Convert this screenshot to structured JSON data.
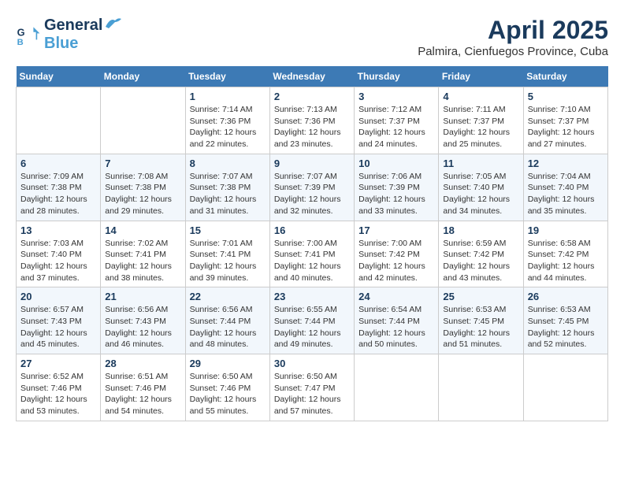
{
  "header": {
    "logo_line1": "General",
    "logo_line2": "Blue",
    "month": "April 2025",
    "location": "Palmira, Cienfuegos Province, Cuba"
  },
  "days_of_week": [
    "Sunday",
    "Monday",
    "Tuesday",
    "Wednesday",
    "Thursday",
    "Friday",
    "Saturday"
  ],
  "weeks": [
    [
      {
        "day": "",
        "info": ""
      },
      {
        "day": "",
        "info": ""
      },
      {
        "day": "1",
        "info": "Sunrise: 7:14 AM\nSunset: 7:36 PM\nDaylight: 12 hours and 22 minutes."
      },
      {
        "day": "2",
        "info": "Sunrise: 7:13 AM\nSunset: 7:36 PM\nDaylight: 12 hours and 23 minutes."
      },
      {
        "day": "3",
        "info": "Sunrise: 7:12 AM\nSunset: 7:37 PM\nDaylight: 12 hours and 24 minutes."
      },
      {
        "day": "4",
        "info": "Sunrise: 7:11 AM\nSunset: 7:37 PM\nDaylight: 12 hours and 25 minutes."
      },
      {
        "day": "5",
        "info": "Sunrise: 7:10 AM\nSunset: 7:37 PM\nDaylight: 12 hours and 27 minutes."
      }
    ],
    [
      {
        "day": "6",
        "info": "Sunrise: 7:09 AM\nSunset: 7:38 PM\nDaylight: 12 hours and 28 minutes."
      },
      {
        "day": "7",
        "info": "Sunrise: 7:08 AM\nSunset: 7:38 PM\nDaylight: 12 hours and 29 minutes."
      },
      {
        "day": "8",
        "info": "Sunrise: 7:07 AM\nSunset: 7:38 PM\nDaylight: 12 hours and 31 minutes."
      },
      {
        "day": "9",
        "info": "Sunrise: 7:07 AM\nSunset: 7:39 PM\nDaylight: 12 hours and 32 minutes."
      },
      {
        "day": "10",
        "info": "Sunrise: 7:06 AM\nSunset: 7:39 PM\nDaylight: 12 hours and 33 minutes."
      },
      {
        "day": "11",
        "info": "Sunrise: 7:05 AM\nSunset: 7:40 PM\nDaylight: 12 hours and 34 minutes."
      },
      {
        "day": "12",
        "info": "Sunrise: 7:04 AM\nSunset: 7:40 PM\nDaylight: 12 hours and 35 minutes."
      }
    ],
    [
      {
        "day": "13",
        "info": "Sunrise: 7:03 AM\nSunset: 7:40 PM\nDaylight: 12 hours and 37 minutes."
      },
      {
        "day": "14",
        "info": "Sunrise: 7:02 AM\nSunset: 7:41 PM\nDaylight: 12 hours and 38 minutes."
      },
      {
        "day": "15",
        "info": "Sunrise: 7:01 AM\nSunset: 7:41 PM\nDaylight: 12 hours and 39 minutes."
      },
      {
        "day": "16",
        "info": "Sunrise: 7:00 AM\nSunset: 7:41 PM\nDaylight: 12 hours and 40 minutes."
      },
      {
        "day": "17",
        "info": "Sunrise: 7:00 AM\nSunset: 7:42 PM\nDaylight: 12 hours and 42 minutes."
      },
      {
        "day": "18",
        "info": "Sunrise: 6:59 AM\nSunset: 7:42 PM\nDaylight: 12 hours and 43 minutes."
      },
      {
        "day": "19",
        "info": "Sunrise: 6:58 AM\nSunset: 7:42 PM\nDaylight: 12 hours and 44 minutes."
      }
    ],
    [
      {
        "day": "20",
        "info": "Sunrise: 6:57 AM\nSunset: 7:43 PM\nDaylight: 12 hours and 45 minutes."
      },
      {
        "day": "21",
        "info": "Sunrise: 6:56 AM\nSunset: 7:43 PM\nDaylight: 12 hours and 46 minutes."
      },
      {
        "day": "22",
        "info": "Sunrise: 6:56 AM\nSunset: 7:44 PM\nDaylight: 12 hours and 48 minutes."
      },
      {
        "day": "23",
        "info": "Sunrise: 6:55 AM\nSunset: 7:44 PM\nDaylight: 12 hours and 49 minutes."
      },
      {
        "day": "24",
        "info": "Sunrise: 6:54 AM\nSunset: 7:44 PM\nDaylight: 12 hours and 50 minutes."
      },
      {
        "day": "25",
        "info": "Sunrise: 6:53 AM\nSunset: 7:45 PM\nDaylight: 12 hours and 51 minutes."
      },
      {
        "day": "26",
        "info": "Sunrise: 6:53 AM\nSunset: 7:45 PM\nDaylight: 12 hours and 52 minutes."
      }
    ],
    [
      {
        "day": "27",
        "info": "Sunrise: 6:52 AM\nSunset: 7:46 PM\nDaylight: 12 hours and 53 minutes."
      },
      {
        "day": "28",
        "info": "Sunrise: 6:51 AM\nSunset: 7:46 PM\nDaylight: 12 hours and 54 minutes."
      },
      {
        "day": "29",
        "info": "Sunrise: 6:50 AM\nSunset: 7:46 PM\nDaylight: 12 hours and 55 minutes."
      },
      {
        "day": "30",
        "info": "Sunrise: 6:50 AM\nSunset: 7:47 PM\nDaylight: 12 hours and 57 minutes."
      },
      {
        "day": "",
        "info": ""
      },
      {
        "day": "",
        "info": ""
      },
      {
        "day": "",
        "info": ""
      }
    ]
  ]
}
